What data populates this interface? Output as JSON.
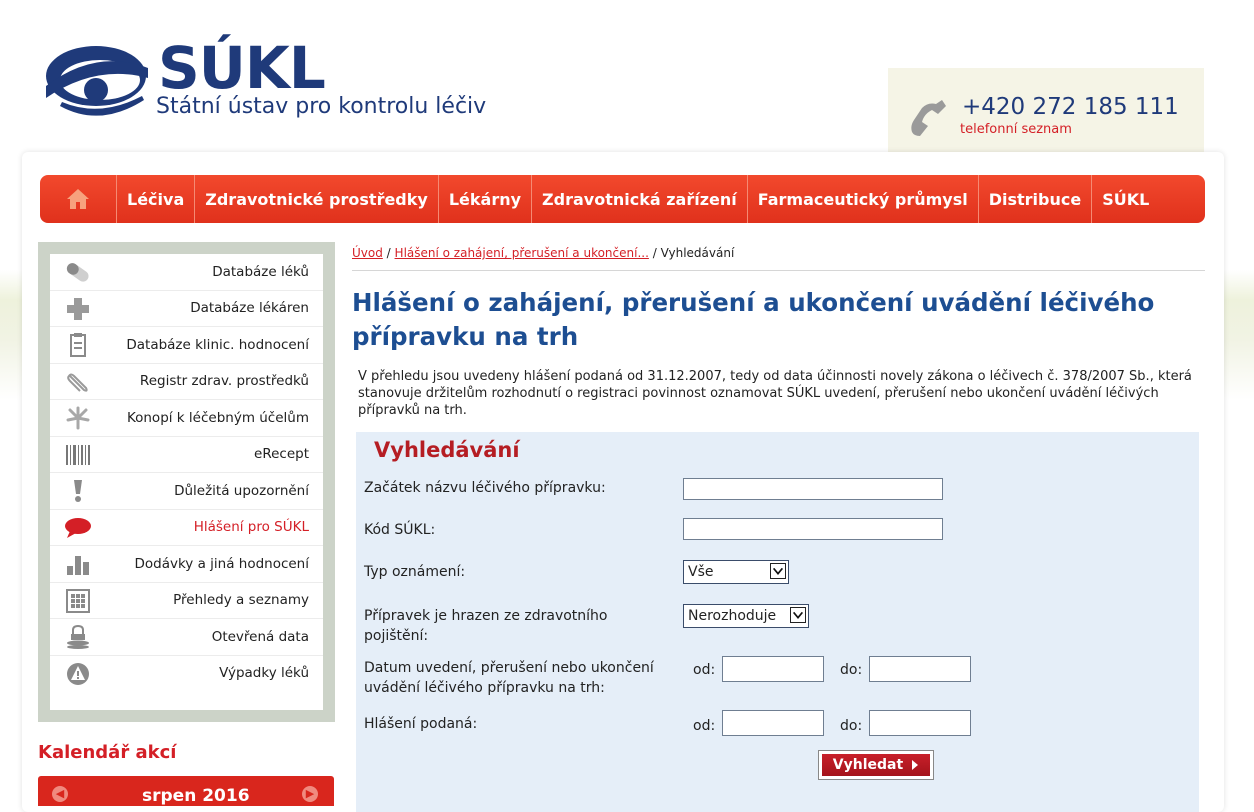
{
  "header": {
    "logo_text": "SÚKL",
    "logo_subtitle": "Státní ústav pro kontrolu léčiv",
    "phone_number": "+420 272 185 111",
    "phone_link": "telefonní seznam",
    "brand_color": "#1f3a7a",
    "accent_color": "#d41f26"
  },
  "nav": {
    "home_icon": "home-icon",
    "items": [
      "Léčiva",
      "Zdravotnické prostředky",
      "Lékárny",
      "Zdravotnická zařízení",
      "Farmaceutický průmysl",
      "Distribuce",
      "SÚKL"
    ]
  },
  "sidebar": {
    "items": [
      {
        "label": "Databáze léků",
        "icon": "pill-icon"
      },
      {
        "label": "Databáze lékáren",
        "icon": "cross-icon"
      },
      {
        "label": "Databáze klinic. hodnocení",
        "icon": "clipboard-icon"
      },
      {
        "label": "Registr zdrav. prostředků",
        "icon": "paperclip-icon"
      },
      {
        "label": "Konopí k léčebným účelům",
        "icon": "cannabis-leaf-icon"
      },
      {
        "label": "eRecept",
        "icon": "barcode-icon"
      },
      {
        "label": "Důležitá upozornění",
        "icon": "exclamation-icon"
      },
      {
        "label": "Hlášení pro SÚKL",
        "icon": "speech-bubble-icon",
        "active": true
      },
      {
        "label": "Dodávky a jiná hodnocení",
        "icon": "bar-chart-icon"
      },
      {
        "label": "Přehledy a seznamy",
        "icon": "grid-icon"
      },
      {
        "label": "Otevřená data",
        "icon": "database-lock-icon"
      },
      {
        "label": "Výpadky léků",
        "icon": "warning-icon"
      }
    ],
    "calendar_title": "Kalendář akcí",
    "calendar_month": "srpen 2016"
  },
  "breadcrumb": {
    "home": "Úvod",
    "separator": "/",
    "parent": "Hlášení o zahájení, přerušení a ukončení...",
    "current": "Vyhledávání"
  },
  "page_title": "Hlášení o zahájení, přerušení a ukončení uvádění léčivého přípravku na trh",
  "intro_text": "V přehledu jsou uvedeny hlášení podaná od 31.12.2007, tedy od data účinnosti novely zákona o léčivech č. 378/2007 Sb., která stanovuje držitelům rozhodnutí o registraci povinnost oznamovat SÚKL uvedení, přerušení nebo ukončení uvádění léčivých přípravků na trh.",
  "search": {
    "title": "Vyhledávání",
    "name_label": "Začátek názvu léčivého přípravku:",
    "name_value": "",
    "code_label": "Kód SÚKL:",
    "code_value": "",
    "type_label": "Typ oznámení:",
    "type_selected": "Vše",
    "insurance_label": "Přípravek je hrazen ze zdravotního pojištění:",
    "insurance_selected": "Nerozhoduje",
    "date_label": "Datum uvedení, přerušení nebo ukončení uvádění léčivého přípravku na trh:",
    "report_label": "Hlášení podaná:",
    "from_label": "od:",
    "to_label": "do:",
    "submit_label": "Vyhledat"
  }
}
